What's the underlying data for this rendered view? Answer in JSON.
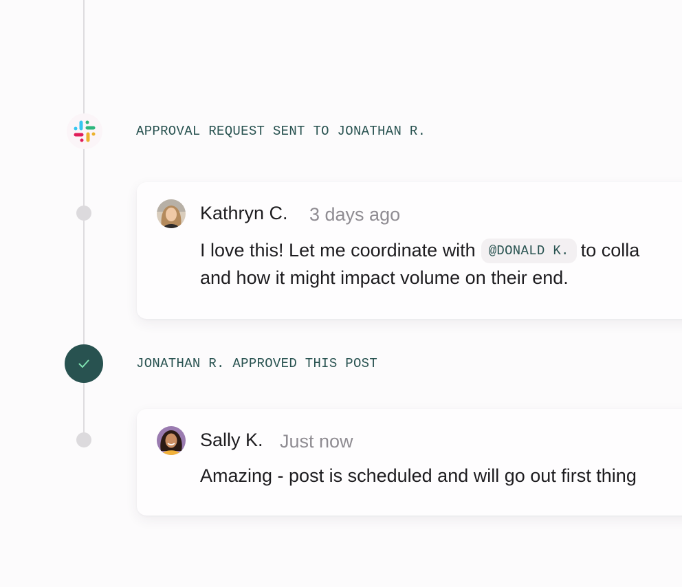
{
  "timeline": {
    "events": [
      {
        "icon": "slack-icon",
        "label": "APPROVAL REQUEST SENT TO JONATHAN R."
      },
      {
        "icon": "check-icon",
        "label": "JONATHAN R. APPROVED THIS POST"
      }
    ],
    "comments": [
      {
        "author": "Kathryn C.",
        "time": "3 days ago",
        "text_before": "I love this! Let me coordinate with",
        "mention": "@DONALD K.",
        "text_after": "to colla",
        "line2": "and how it might impact volume on their end."
      },
      {
        "author": "Sally K.",
        "time": "Just now",
        "text": "Amazing - post is scheduled and will go out first thing"
      }
    ]
  },
  "colors": {
    "accent": "#285250",
    "check": "#7ee0b0",
    "dot": "#dcdadd",
    "line": "#dedcdf",
    "muted_text": "#8f8c92"
  }
}
